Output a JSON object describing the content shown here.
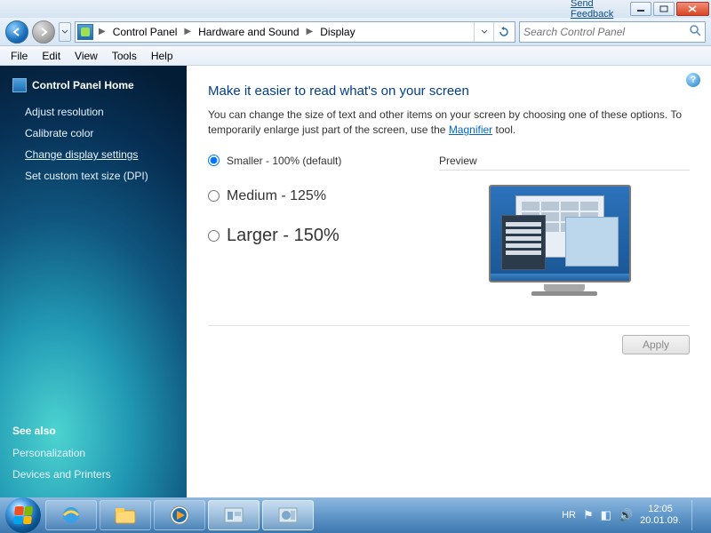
{
  "titlebar": {
    "feedback": "Send Feedback"
  },
  "breadcrumbs": {
    "b1": "Control Panel",
    "b2": "Hardware and Sound",
    "b3": "Display"
  },
  "search": {
    "placeholder": "Search Control Panel"
  },
  "menu": {
    "file": "File",
    "edit": "Edit",
    "view": "View",
    "tools": "Tools",
    "help": "Help"
  },
  "sidebar": {
    "home": "Control Panel Home",
    "links": {
      "adjust": "Adjust resolution",
      "calibrate": "Calibrate color",
      "change": "Change display settings",
      "dpi": "Set custom text size (DPI)"
    },
    "seealso_h": "See also",
    "seealso": {
      "pers": "Personalization",
      "dev": "Devices and Printers"
    }
  },
  "main": {
    "heading": "Make it easier to read what's on your screen",
    "lead_a": "You can change the size of text and other items on your screen by choosing one of these options. To temporarily enlarge just part of the screen, use the ",
    "lead_link": "Magnifier",
    "lead_b": " tool.",
    "opt_small": "Smaller - 100% (default)",
    "opt_med": "Medium - 125%",
    "opt_large": "Larger - 150%",
    "preview": "Preview",
    "apply": "Apply"
  },
  "tray": {
    "lang": "HR",
    "time": "12:05",
    "date": "20.01.09."
  }
}
